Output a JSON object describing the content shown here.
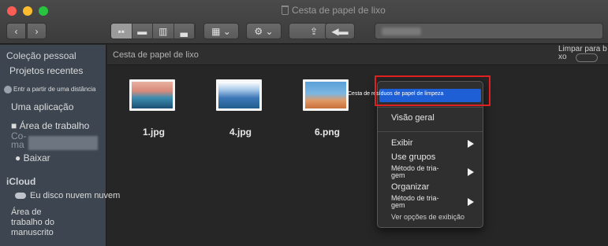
{
  "window": {
    "title": "Cesta de papel de lixo"
  },
  "toolbar": {
    "back_label": "‹",
    "forward_label": "›",
    "gear_label": "⚙ ⌄",
    "group_label": "▦ ⌄"
  },
  "sidebar": {
    "heading_personal": "Coleção pessoal",
    "items": [
      {
        "label": "Projetos recentes"
      },
      {
        "label": "Entr a partir de uma distância"
      },
      {
        "label": "Uma aplicação"
      },
      {
        "label": "Área de trabalho"
      },
      {
        "label": "Co-\nma"
      },
      {
        "label": "Baixar"
      }
    ],
    "heading_icloud": "iCloud",
    "icloud_item": "Eu disco nuvem nuvem",
    "last_item": "Área de\ntrabalho do\nmanuscrito"
  },
  "pathbar": {
    "label": "Cesta de papel de lixo",
    "empty_label": "Limpar para b\nxo"
  },
  "files": [
    {
      "name": "1.jpg"
    },
    {
      "name": "4.jpg"
    },
    {
      "name": "6.png"
    }
  ],
  "context_menu": {
    "highlighted": "Cesta de resíduos de papel de limpeza",
    "overview": "Visão geral",
    "show": "Exibir",
    "use_groups": "Use grupos",
    "sort_method_1": "Método de tria-\ngem",
    "organize": "Organizar",
    "sort_method_2": "Método de tria-\ngem",
    "view_options": "Ver opções de exibição"
  },
  "colors": {
    "highlight": "#1f5fd6",
    "annotation": "#e02020"
  }
}
